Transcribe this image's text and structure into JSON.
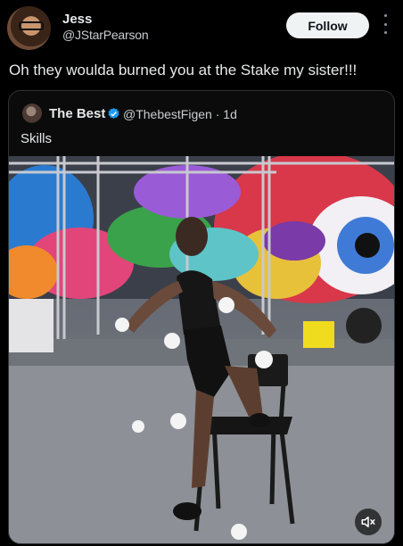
{
  "tweet": {
    "author_name": "Jess",
    "author_handle": "@JStarPearson",
    "follow_label": "Follow",
    "text": "Oh they woulda burned you at the Stake my sister!!!"
  },
  "quote": {
    "author_name": "The Best",
    "author_handle": "@ThebestFigen",
    "time": "1d",
    "text": "Skills"
  },
  "icons": {
    "more": "more-icon",
    "verified": "verified-icon",
    "mute": "mute-icon"
  },
  "colors": {
    "background": "#000000",
    "follow_button": "#eff3f4",
    "verified_badge": "#1d9bf0"
  }
}
